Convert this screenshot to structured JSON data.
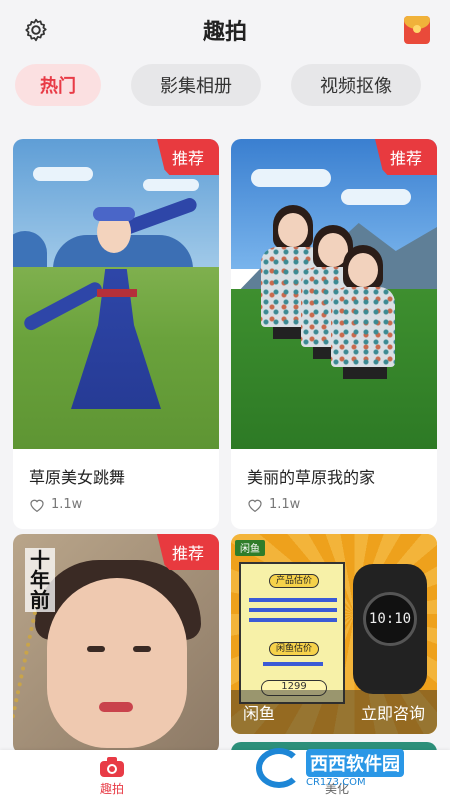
{
  "header": {
    "title": "趣拍",
    "settings_icon": "gear-icon",
    "gift_icon": "red-envelope-icon"
  },
  "tabs": [
    {
      "label": "热门",
      "active": true
    },
    {
      "label": "影集相册",
      "active": false
    },
    {
      "label": "视频抠像",
      "active": false
    }
  ],
  "cards": [
    {
      "badge": "推荐",
      "name": "草原美女跳舞",
      "likes": "1.1w"
    },
    {
      "badge": "推荐",
      "name": "美丽的草原我的家",
      "likes": "1.1w"
    },
    {
      "badge": "推荐",
      "overlay_text": "十年前"
    },
    {
      "ad_tag": "闲鱼",
      "ad_left": "闲鱼",
      "ad_right": "立即咨询",
      "board_title": "产品估价",
      "board_sub": "闲鱼估价",
      "board_price": "1299",
      "watch_time": "10:10"
    }
  ],
  "nav": [
    {
      "label": "趣拍",
      "icon": "camera-icon",
      "active": true
    },
    {
      "label": "美化",
      "icon": "beautify-icon",
      "active": false
    }
  ],
  "watermark": {
    "brand": "西西软件园",
    "domain": "CR173.COM"
  },
  "colors": {
    "accent": "#e83b46",
    "tab_active_bg": "#fbe0e1",
    "badge": "#e83a3f"
  }
}
